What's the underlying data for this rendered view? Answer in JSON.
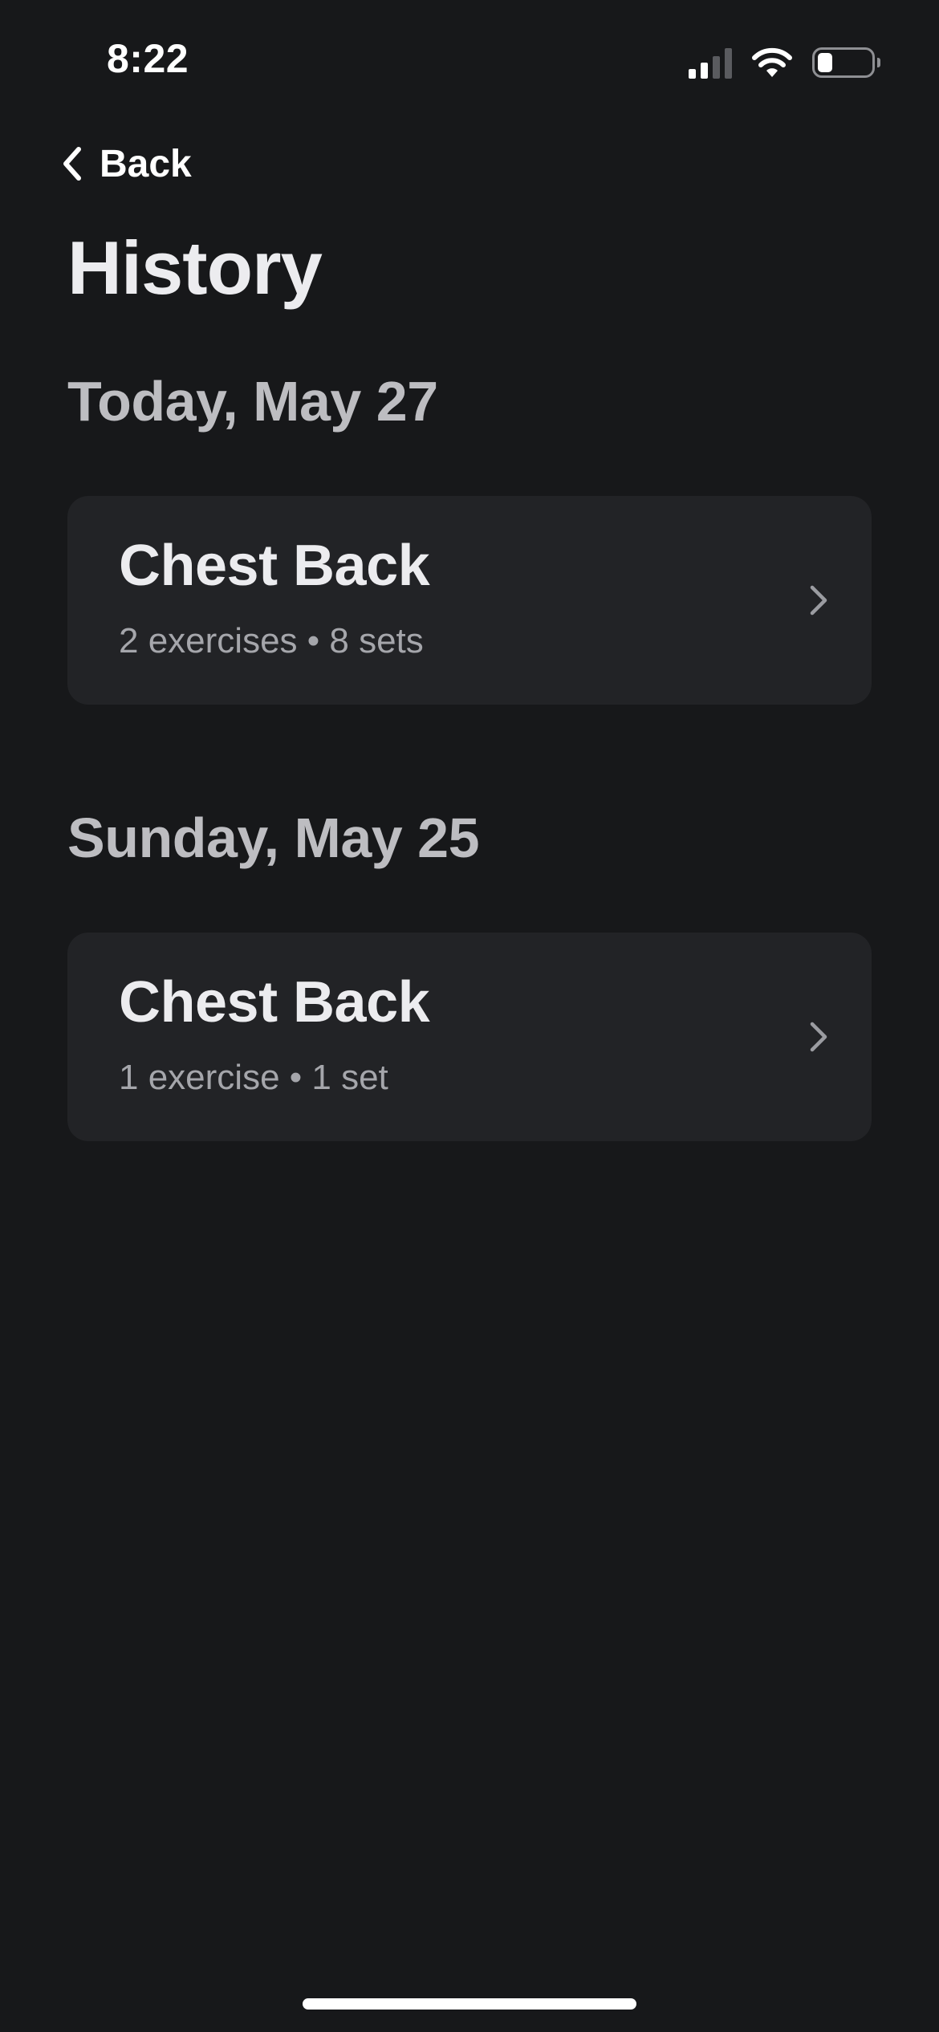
{
  "status_bar": {
    "time": "8:22",
    "icons": [
      "cellular-signal-icon",
      "wifi-icon",
      "battery-icon"
    ]
  },
  "nav": {
    "back_label": "Back",
    "back_icon": "chevron-left-icon"
  },
  "page": {
    "title": "History"
  },
  "sections": [
    {
      "date": "Today, May 27",
      "workouts": [
        {
          "title": "Chest Back",
          "subtitle": "2 exercises • 8 sets"
        }
      ]
    },
    {
      "date": "Sunday, May 25",
      "workouts": [
        {
          "title": "Chest Back",
          "subtitle": "1 exercise • 1 set"
        }
      ]
    }
  ],
  "colors": {
    "background": "#17181a",
    "card": "#222326",
    "title_text": "#ececef",
    "section_text": "#bdbdc1",
    "secondary_text": "#a5a6ab"
  }
}
